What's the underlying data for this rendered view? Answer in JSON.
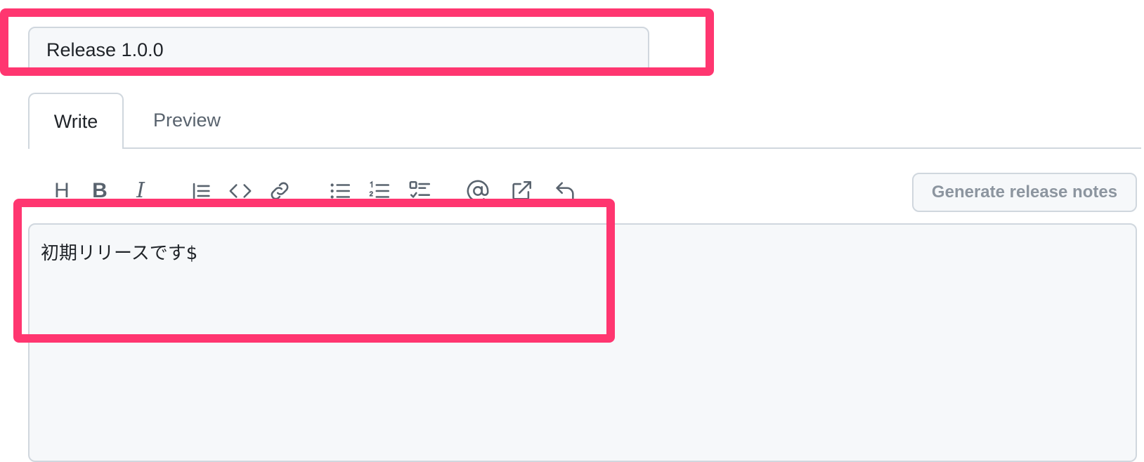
{
  "release": {
    "title_value": "Release 1.0.0"
  },
  "tabs": {
    "write_label": "Write",
    "preview_label": "Preview"
  },
  "toolbar": {
    "icons": [
      "heading-icon",
      "bold-icon",
      "italic-icon",
      "quote-icon",
      "code-icon",
      "link-icon",
      "bulleted-list-icon",
      "numbered-list-icon",
      "task-list-icon",
      "mention-icon",
      "cross-reference-icon",
      "reply-icon"
    ],
    "heading_glyph": "H",
    "bold_glyph": "B",
    "italic_glyph": "I",
    "generate_label": "Generate release notes"
  },
  "body": {
    "value": "初期リリースです$"
  },
  "colors": {
    "highlight": "#ff3670",
    "input_bg": "#f6f8fa",
    "border": "#d0d7de",
    "muted_text": "#59636e"
  }
}
